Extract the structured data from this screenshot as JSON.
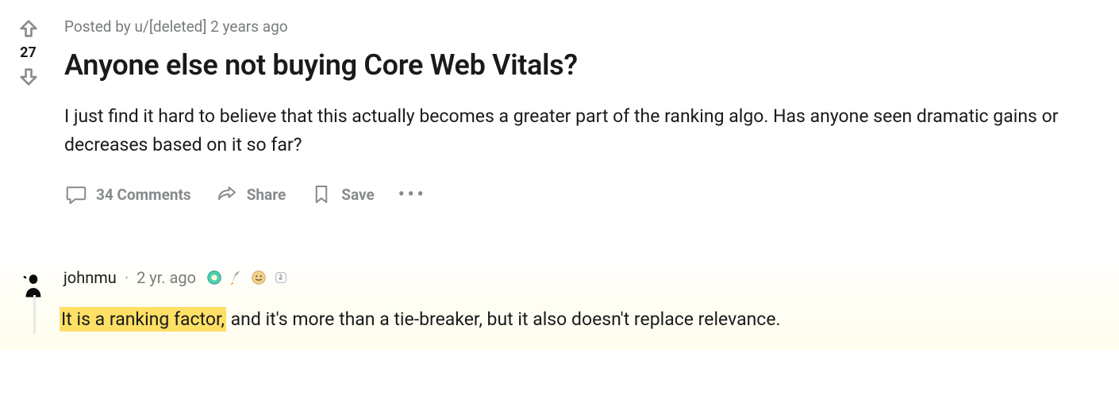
{
  "post": {
    "byline_prefix": "Posted by ",
    "author_prefix": "u/",
    "author": "[deleted]",
    "age": "2 years ago",
    "score": "27",
    "title": "Anyone else not buying Core Web Vitals?",
    "body": "I just find it hard to believe that this actually becomes a greater part of the ranking algo. Has anyone seen dramatic gains or decreases based on it so far?",
    "actions": {
      "comments": "34 Comments",
      "share": "Share",
      "save": "Save",
      "more": "•••"
    }
  },
  "comment": {
    "author": "johnmu",
    "sep": "·",
    "age": "2 yr. ago",
    "badges": [
      "award-wholesome",
      "award-rocket",
      "award-hug",
      "award-silver"
    ],
    "highlighted": "It is a ranking factor,",
    "rest": " and it's more than a tie-breaker, but it also doesn't replace relevance."
  }
}
